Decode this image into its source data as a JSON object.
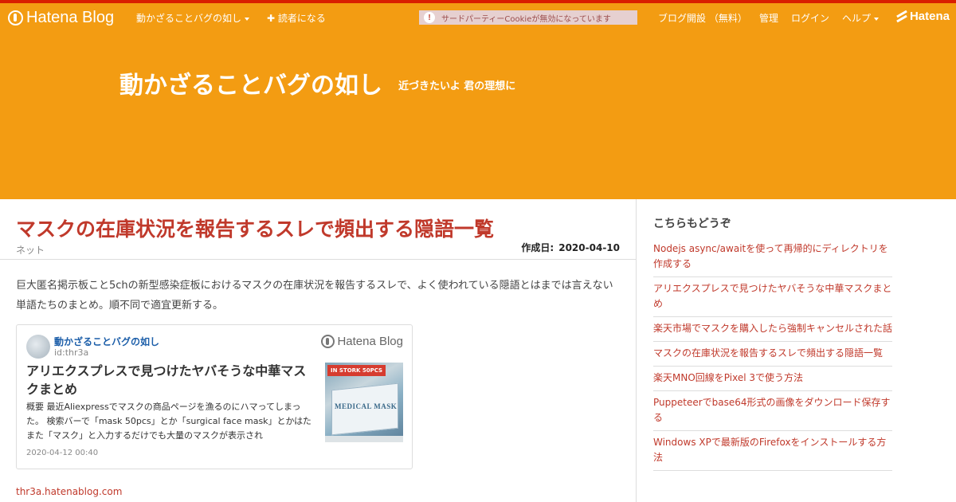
{
  "topbar": {
    "logo_text": "Hatena Blog",
    "blog_menu_label": "動かざることバグの如し",
    "subscribe_label": "✚ 読者になる",
    "cookie_warning": "サードパーティーCookieが無効になっています",
    "warning_icon_glyph": "!",
    "start_blog_label": "ブログ開設 （無料）",
    "admin_label": "管理",
    "login_label": "ログイン",
    "help_label": "ヘルプ",
    "hatena_label": "Hatena",
    "bar_color": "#f39c12",
    "accent_top_color": "#d91e00"
  },
  "header": {
    "title": "動かざることバグの如し",
    "description": "近づきたいよ 君の理想に",
    "background": "#f39c12"
  },
  "article": {
    "title": "マスクの在庫状況を報告するスレで頻出する隠語一覧",
    "category": "ネット",
    "date_label": "作成日:",
    "date_value": "2020-04-10",
    "intro": "巨大匿名掲示板こと5chの新型感染症板におけるマスクの在庫状況を報告するスレで、よく使われている隠語とはまでは言えない単語たちのまとめ。順不同で適宜更新する。",
    "title_color": "#c0392b"
  },
  "embed": {
    "blog_name": "動かざることバグの如し",
    "user_id": "id:thr3a",
    "brand": "Hatena Blog",
    "title": "アリエクスプレスで見つけたヤバそうな中華マスクまとめ",
    "summary": "概要 最近Aliexpressでマスクの商品ページを漁るのにハマってしまった。 検索バーで「mask 50pcs」とか「surgical face mask」とかはたまた「マスク」と入力するだけでも大量のマスクが表示され",
    "date": "2020-04-12 00:40",
    "thumb_badge": "IN STORK 50PCS",
    "thumb_label": "MEDICAL MASK"
  },
  "footer_link": "thr3a.hatenablog.com",
  "sidebar": {
    "heading": "こちらもどうぞ",
    "items": [
      {
        "label": "Nodejs async/awaitを使って再帰的にディレクトリを作成する"
      },
      {
        "label": "アリエクスプレスで見つけたヤバそうな中華マスクまとめ"
      },
      {
        "label": "楽天市場でマスクを購入したら強制キャンセルされた話"
      },
      {
        "label": "マスクの在庫状況を報告するスレで頻出する隠語一覧"
      },
      {
        "label": "楽天MNO回線をPixel 3で使う方法"
      },
      {
        "label": "Puppeteerでbase64形式の画像をダウンロード保存する"
      },
      {
        "label": "Windows XPで最新版のFirefoxをインストールする方法"
      }
    ],
    "link_color": "#c0392b"
  }
}
